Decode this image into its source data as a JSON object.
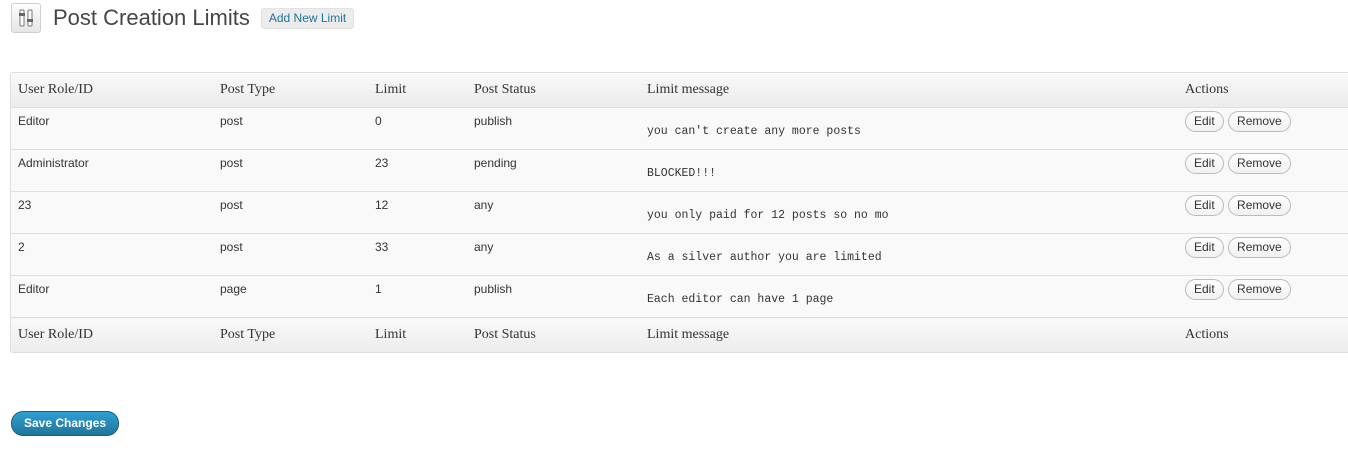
{
  "header": {
    "title": "Post Creation Limits",
    "add_new_label": "Add New Limit",
    "icon": "settings-sliders-icon"
  },
  "table": {
    "columns": [
      "User Role/ID",
      "Post Type",
      "Limit",
      "Post Status",
      "Limit message",
      "Actions"
    ],
    "rows": [
      {
        "role": "Editor",
        "post_type": "post",
        "limit": "0",
        "status": "publish",
        "message": "you can't create any more posts",
        "edit": "Edit",
        "remove": "Remove"
      },
      {
        "role": "Administrator",
        "post_type": "post",
        "limit": "23",
        "status": "pending",
        "message": "BLOCKED!!!",
        "edit": "Edit",
        "remove": "Remove"
      },
      {
        "role": "23",
        "post_type": "post",
        "limit": "12",
        "status": "any",
        "message": "you only paid for 12 posts so no mo",
        "edit": "Edit",
        "remove": "Remove"
      },
      {
        "role": "2",
        "post_type": "post",
        "limit": "33",
        "status": "any",
        "message": "As a silver author you are limited",
        "edit": "Edit",
        "remove": "Remove"
      },
      {
        "role": "Editor",
        "post_type": "page",
        "limit": "1",
        "status": "publish",
        "message": "Each editor can have 1 page",
        "edit": "Edit",
        "remove": "Remove"
      }
    ]
  },
  "save_label": "Save Changes",
  "colors": {
    "link": "#21759b",
    "primary_button": "#21759b",
    "header_bg": "#f1f1f1",
    "border": "#dfdfdf"
  }
}
